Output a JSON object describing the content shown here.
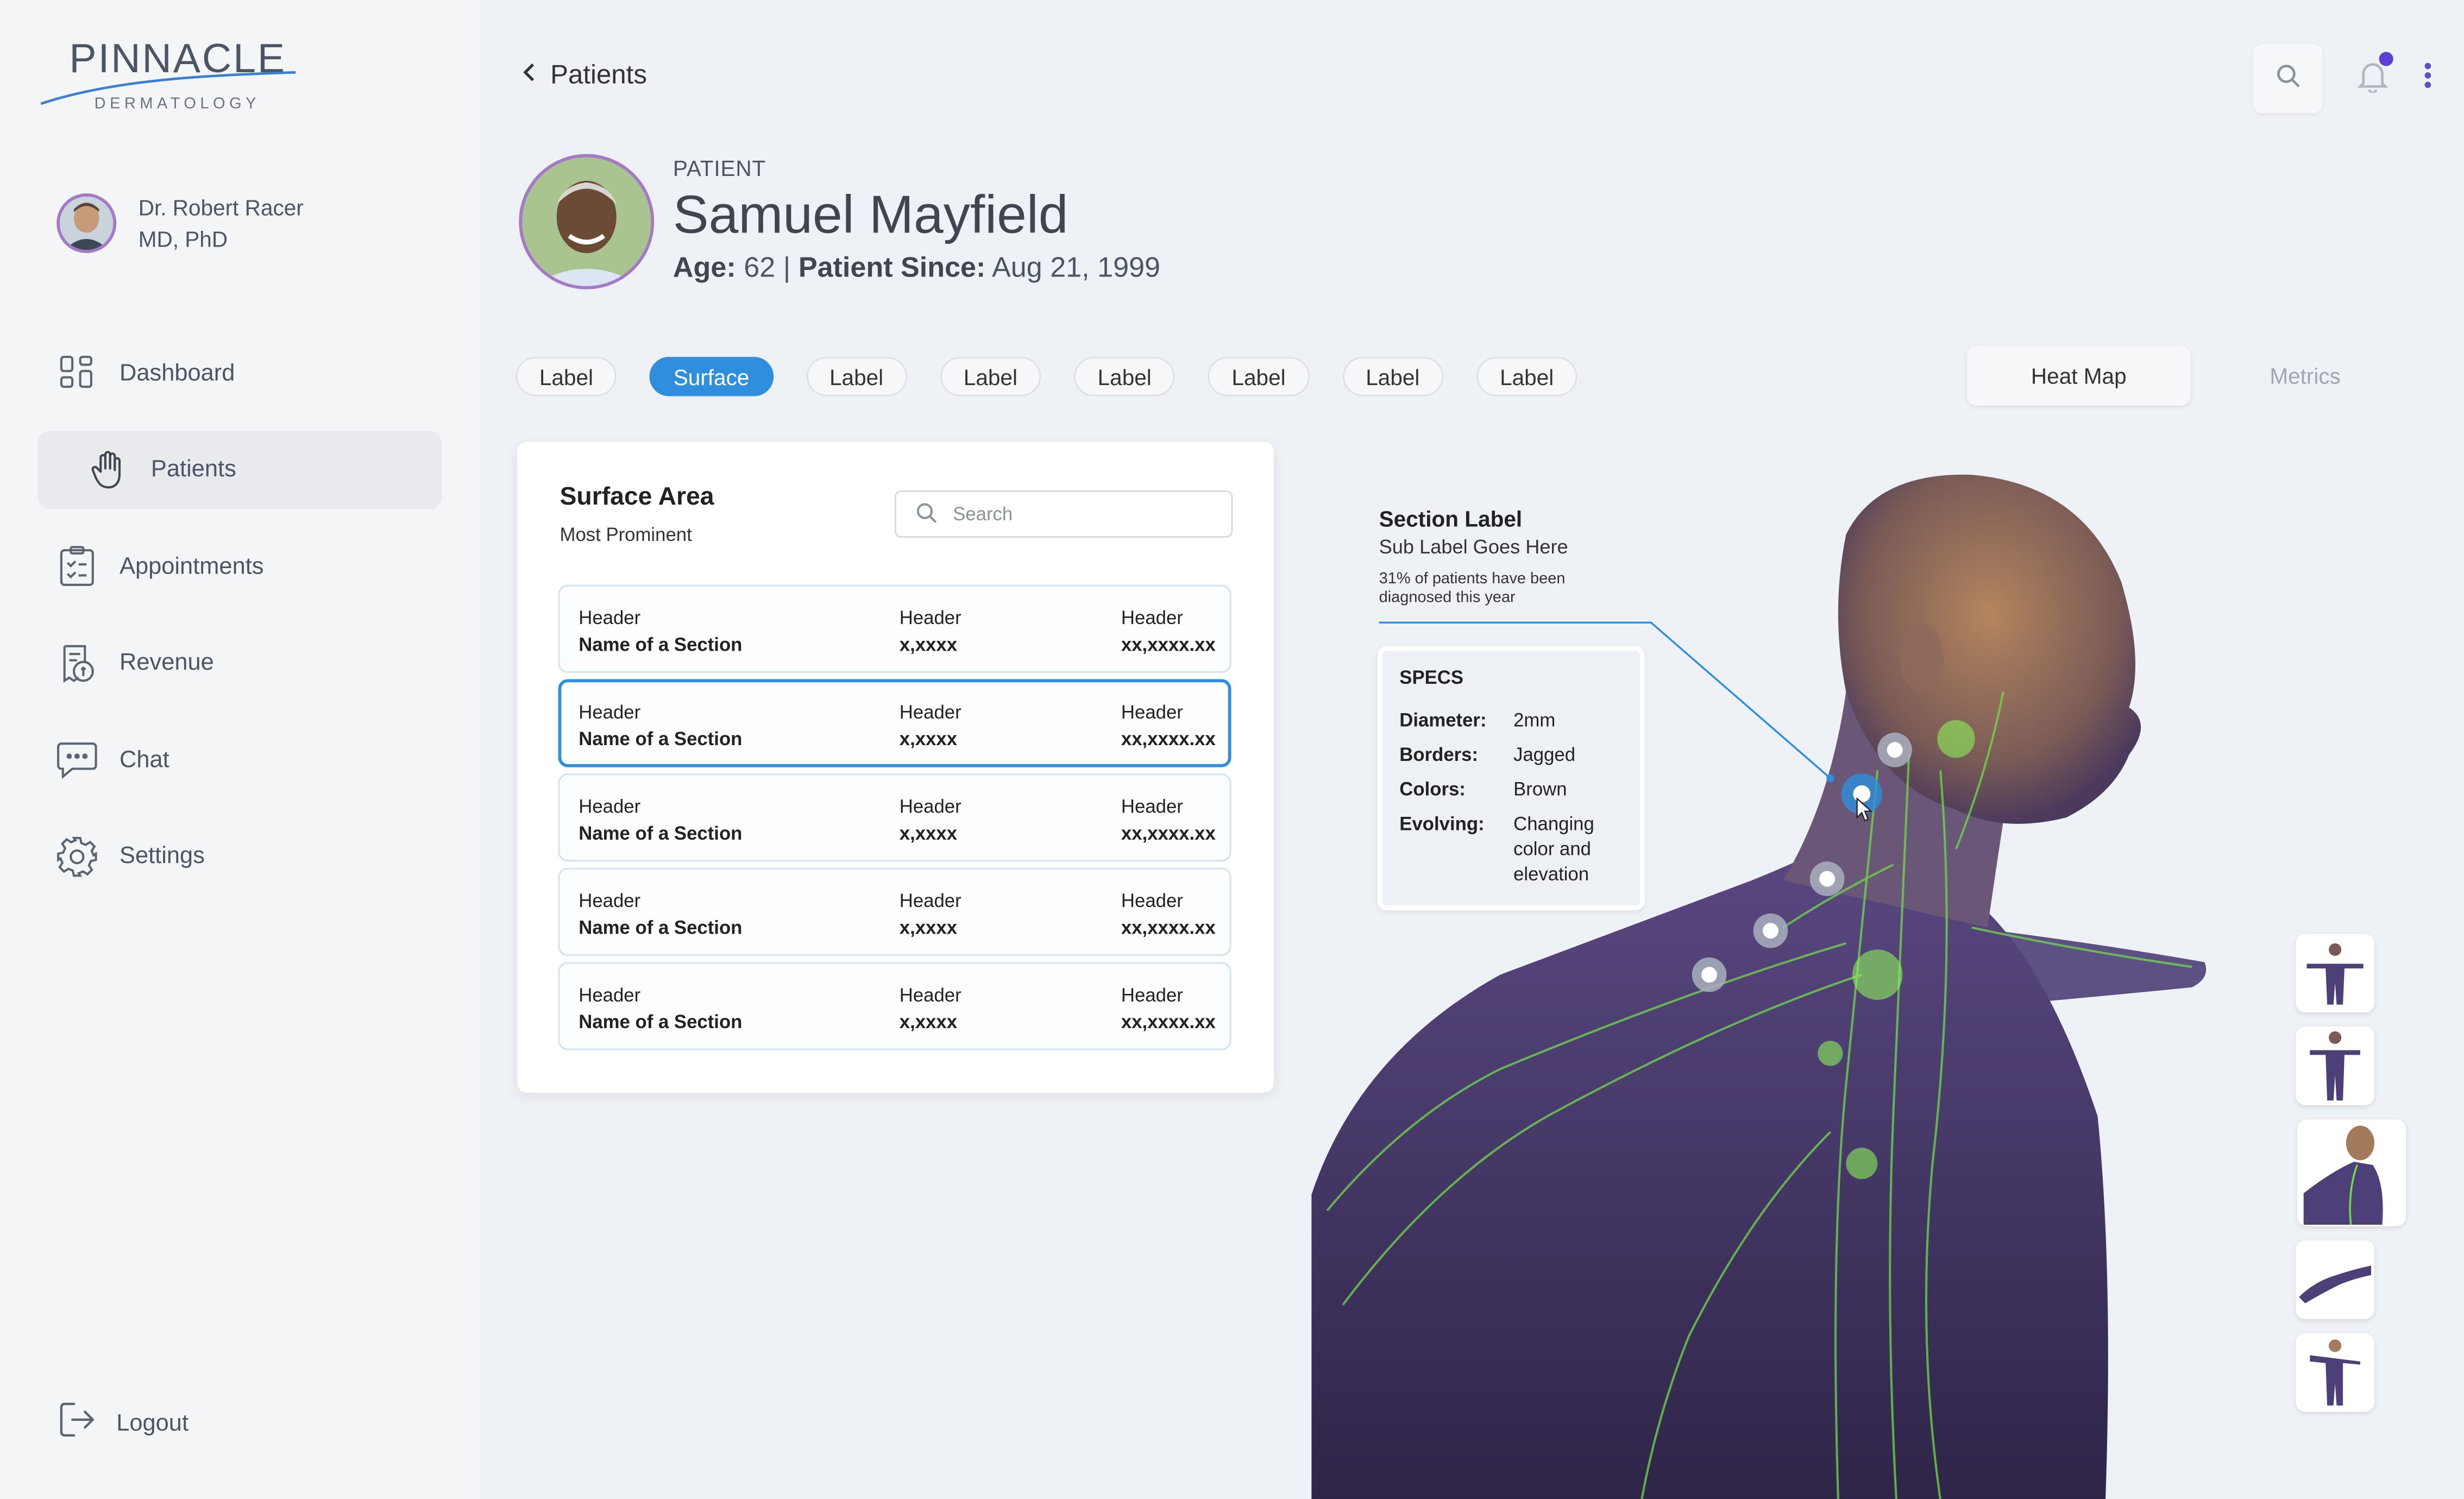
{
  "brand": {
    "name": "PINNACLE",
    "subtitle": "DERMATOLOGY"
  },
  "user": {
    "name": "Dr. Robert Racer",
    "credentials": "MD, PhD"
  },
  "nav": {
    "items": [
      {
        "label": "Dashboard",
        "icon": "grid-icon"
      },
      {
        "label": "Patients",
        "icon": "hand-icon"
      },
      {
        "label": "Appointments",
        "icon": "clipboard-icon"
      },
      {
        "label": "Revenue",
        "icon": "receipt-icon"
      },
      {
        "label": "Chat",
        "icon": "chat-icon"
      },
      {
        "label": "Settings",
        "icon": "gear-icon"
      }
    ],
    "active": "Patients",
    "logout": "Logout"
  },
  "header": {
    "back_label": "Patients"
  },
  "patient": {
    "label": "PATIENT",
    "name": "Samuel Mayfield",
    "age_label": "Age:",
    "age": "62",
    "separator": "|",
    "since_label": "Patient Since:",
    "since": "Aug 21, 1999"
  },
  "tabs": [
    "Label",
    "Surface",
    "Label",
    "Label",
    "Label",
    "Label",
    "Label",
    "Label"
  ],
  "active_tab": "Surface",
  "view_toggle": {
    "active": "Heat  Map",
    "inactive": "Metrics"
  },
  "surface_card": {
    "title": "Surface Area",
    "subtitle": "Most Prominent",
    "search_placeholder": "Search",
    "rows": [
      {
        "h1": "Header",
        "v1": "Name of a Section",
        "h2": "Header",
        "v2": "x,xxxx",
        "h3": "Header",
        "v3": "xx,xxxx.xx"
      },
      {
        "h1": "Header",
        "v1": "Name of a Section",
        "h2": "Header",
        "v2": "x,xxxx",
        "h3": "Header",
        "v3": "xx,xxxx.xx"
      },
      {
        "h1": "Header",
        "v1": "Name of a Section",
        "h2": "Header",
        "v2": "x,xxxx",
        "h3": "Header",
        "v3": "xx,xxxx.xx"
      },
      {
        "h1": "Header",
        "v1": "Name of a Section",
        "h2": "Header",
        "v2": "x,xxxx",
        "h3": "Header",
        "v3": "xx,xxxx.xx"
      },
      {
        "h1": "Header",
        "v1": "Name of a Section",
        "h2": "Header",
        "v2": "x,xxxx",
        "h3": "Header",
        "v3": "xx,xxxx.xx"
      }
    ],
    "selected_row": 1
  },
  "section": {
    "title": "Section Label",
    "subtitle": "Sub Label Goes Here",
    "note": "31% of patients have been diagnosed this year"
  },
  "specs": {
    "title": "SPECS",
    "items": [
      {
        "key": "Diameter:",
        "value": "2mm"
      },
      {
        "key": "Borders:",
        "value": "Jagged"
      },
      {
        "key": "Colors:",
        "value": "Brown"
      },
      {
        "key": "Evolving:",
        "value": "Changing color and elevation"
      }
    ]
  },
  "colors": {
    "accent": "#2f8fde",
    "notification": "#5b3fd6",
    "avatar_border": "#a678c9"
  }
}
